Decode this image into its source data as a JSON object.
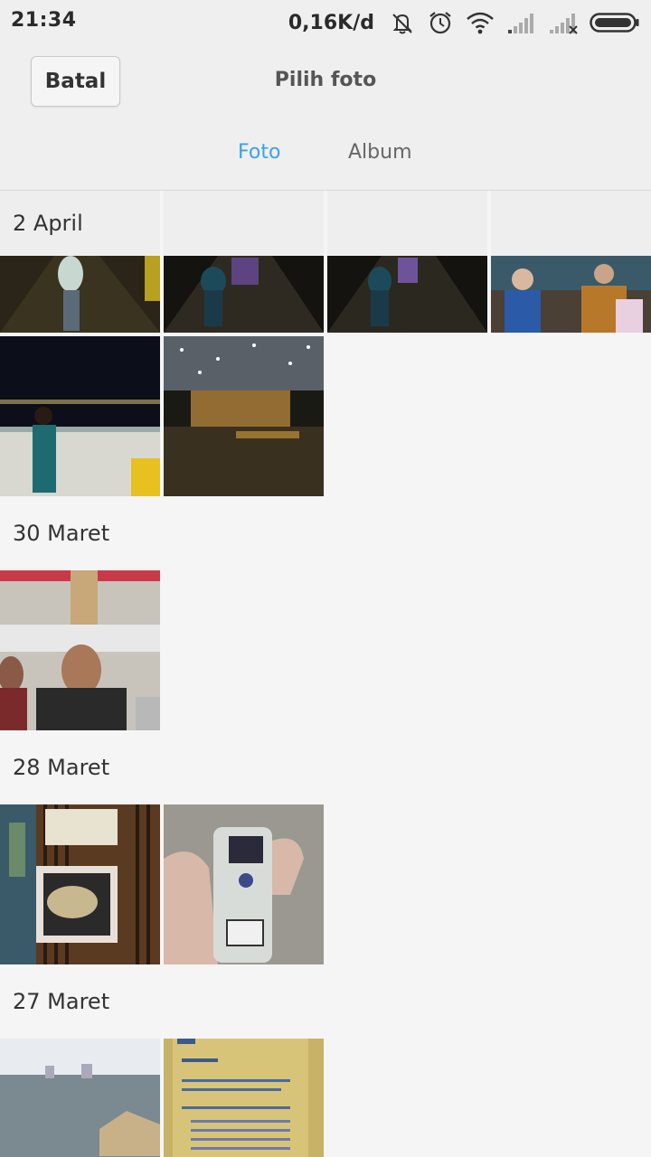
{
  "status_bar": {
    "time": "21:34",
    "net_speed": "0,16K/d",
    "icons": [
      "notifications-off-icon",
      "alarm-icon",
      "wifi-icon",
      "signal-icon",
      "signal-no-service-icon",
      "battery-icon"
    ]
  },
  "header": {
    "cancel_label": "Batal",
    "title": "Pilih foto",
    "tabs": [
      {
        "label": "Foto",
        "active": true
      },
      {
        "label": "Album",
        "active": false
      }
    ],
    "accent_color": "#3aa3e8"
  },
  "sections": [
    {
      "date": "2 April",
      "photo_count": 6
    },
    {
      "date": "30 Maret",
      "photo_count": 1
    },
    {
      "date": "28 Maret",
      "photo_count": 2
    },
    {
      "date": "27 Maret",
      "photo_count": 2
    }
  ]
}
